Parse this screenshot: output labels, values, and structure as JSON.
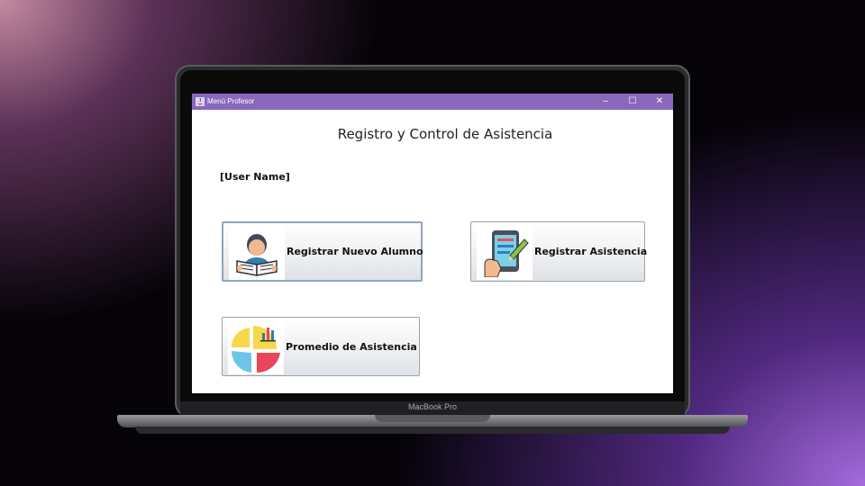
{
  "window": {
    "title": "Menú Profesor",
    "controls": {
      "minimize": "–",
      "maximize": "☐",
      "close": "✕"
    }
  },
  "heading": "Registro y Control de Asistencia",
  "user_name": "[User Name]",
  "buttons": {
    "nuevo_alumno": {
      "label": "Registrar Nuevo Alumno",
      "icon": "student-reading-icon"
    },
    "asistencia": {
      "label": "Registrar Asistencia",
      "icon": "tablet-edit-icon"
    },
    "promedio": {
      "label": "Promedio de Asistencia",
      "icon": "pie-chart-icon"
    }
  },
  "device": {
    "brand": "MacBook Pro"
  },
  "colors": {
    "titlebar": "#8a68bc",
    "background_left": "#c48aa0",
    "background_right": "#a46bdc"
  }
}
